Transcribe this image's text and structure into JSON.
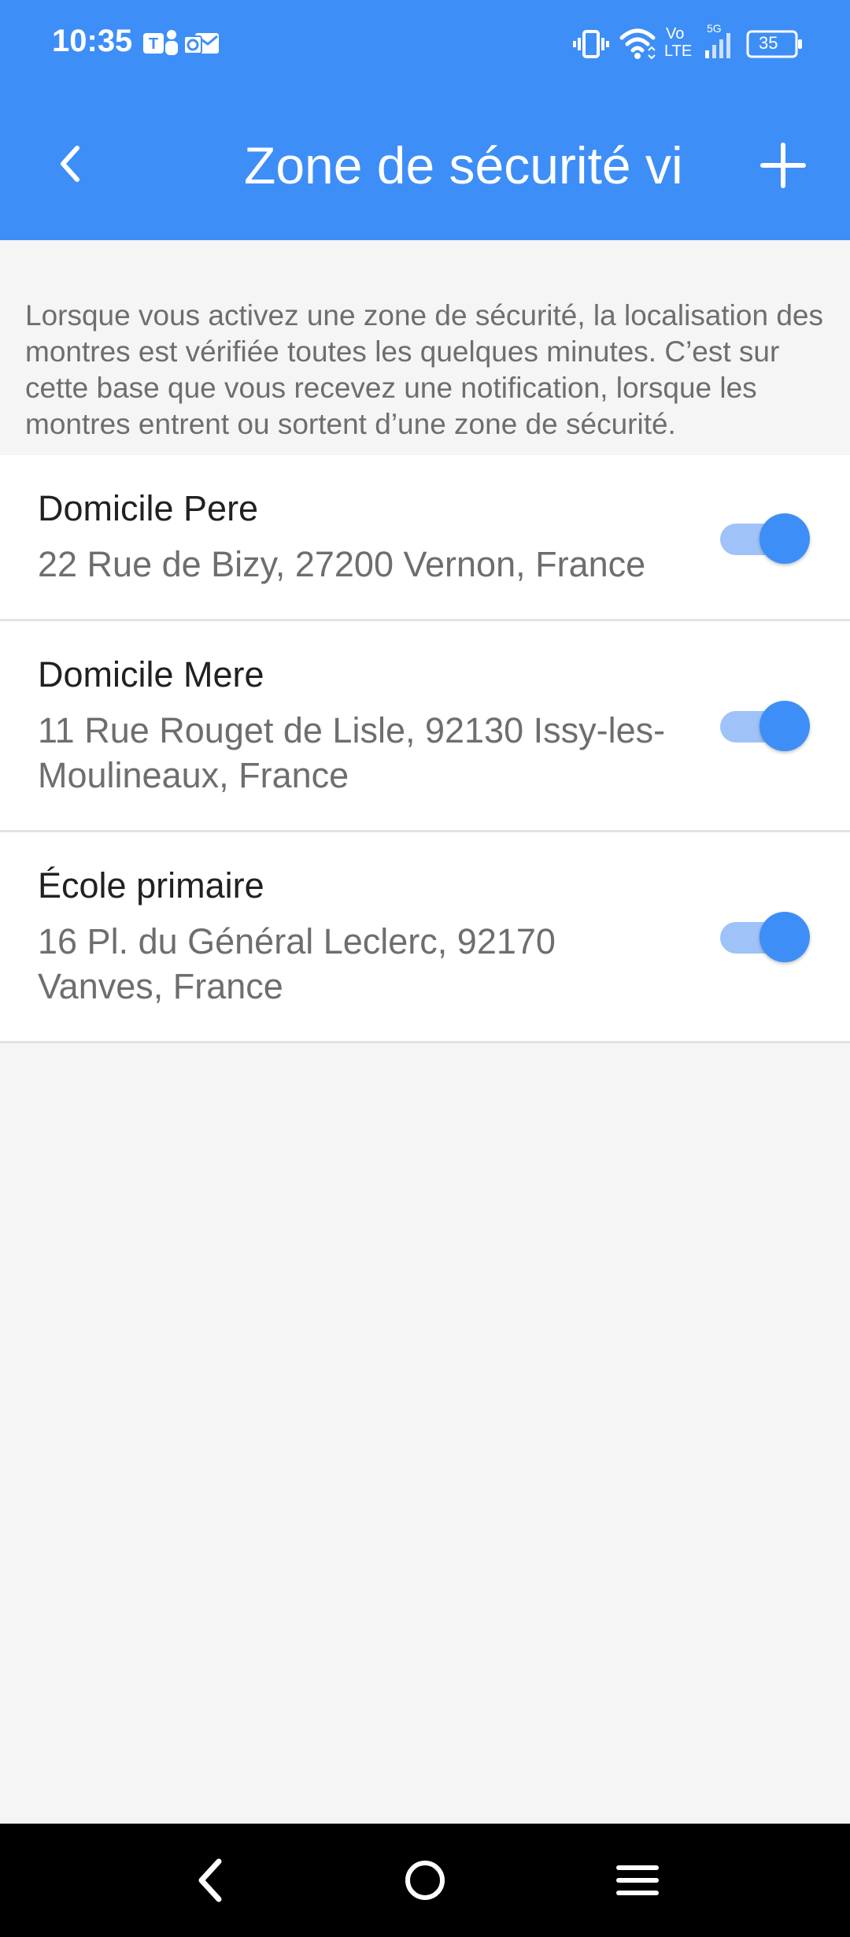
{
  "status_bar": {
    "time": "10:35",
    "network_label_vo": "Vo",
    "network_label_lte": "LTE",
    "network_label_5g": "5G",
    "battery": "35",
    "icons": [
      "teams-icon",
      "outlook-icon",
      "vibrate-icon",
      "wifi-icon",
      "signal-icon",
      "battery-icon"
    ]
  },
  "app_bar": {
    "title": "Zone de sécurité vi",
    "back_icon": "chevron-left-icon",
    "add_icon": "plus-icon"
  },
  "info_text": "Lorsque vous activez une zone de sécurité, la localisation des montres est vérifiée toutes les quelques minutes. C’est sur cette base que vous recevez une notification, lorsque les montres entrent ou sortent d’une zone de sécurité.",
  "zones": [
    {
      "name": "Domicile Pere",
      "address": "22 Rue de Bizy, 27200 Vernon, France",
      "enabled": true
    },
    {
      "name": "Domicile Mere",
      "address": "11 Rue Rouget de Lisle, 92130 Issy-les-Moulineaux, France",
      "enabled": true
    },
    {
      "name": "École primaire",
      "address": "16 Pl. du Général Leclerc, 92170 Vanves, France",
      "enabled": true
    }
  ],
  "nav_bar": {
    "icons": [
      "back-icon",
      "home-icon",
      "menu-icon"
    ]
  },
  "colors": {
    "primary": "#3e8ef7",
    "track": "#9fc2f8",
    "background": "#f5f5f5",
    "text_primary": "#212121",
    "text_secondary": "#6e6e6e"
  }
}
